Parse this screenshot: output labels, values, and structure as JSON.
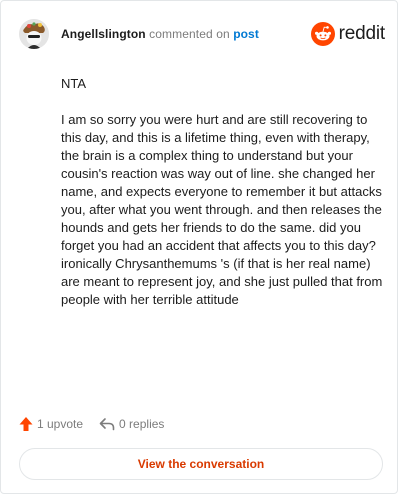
{
  "header": {
    "username": "Angellslington",
    "action_text": "commented on",
    "post_link": "post",
    "brand_name": "reddit",
    "brand_color": "#ff4500"
  },
  "comment": {
    "paragraphs": [
      "NTA",
      "I am so sorry you were hurt and are still recovering to this day, and this is a lifetime thing, even with therapy, the brain is a complex thing to understand but your cousin's reaction was way out of line. she changed her name, and expects everyone to remember it but attacks you, after what you went through. and then releases the hounds and gets her friends to do the same. did you forget you had an accident that affects you to this day? ironically Chrysanthemums 's (if that is her real name) are meant to represent joy, and she just pulled that from people with her terrible attitude"
    ]
  },
  "actions": {
    "upvote_label": "1 upvote",
    "upvote_icon": "upvote-arrow-icon",
    "replies_label": "0 replies",
    "replies_icon": "reply-arrow-icon"
  },
  "cta": {
    "label": "View the conversation",
    "color": "#d93a00"
  }
}
